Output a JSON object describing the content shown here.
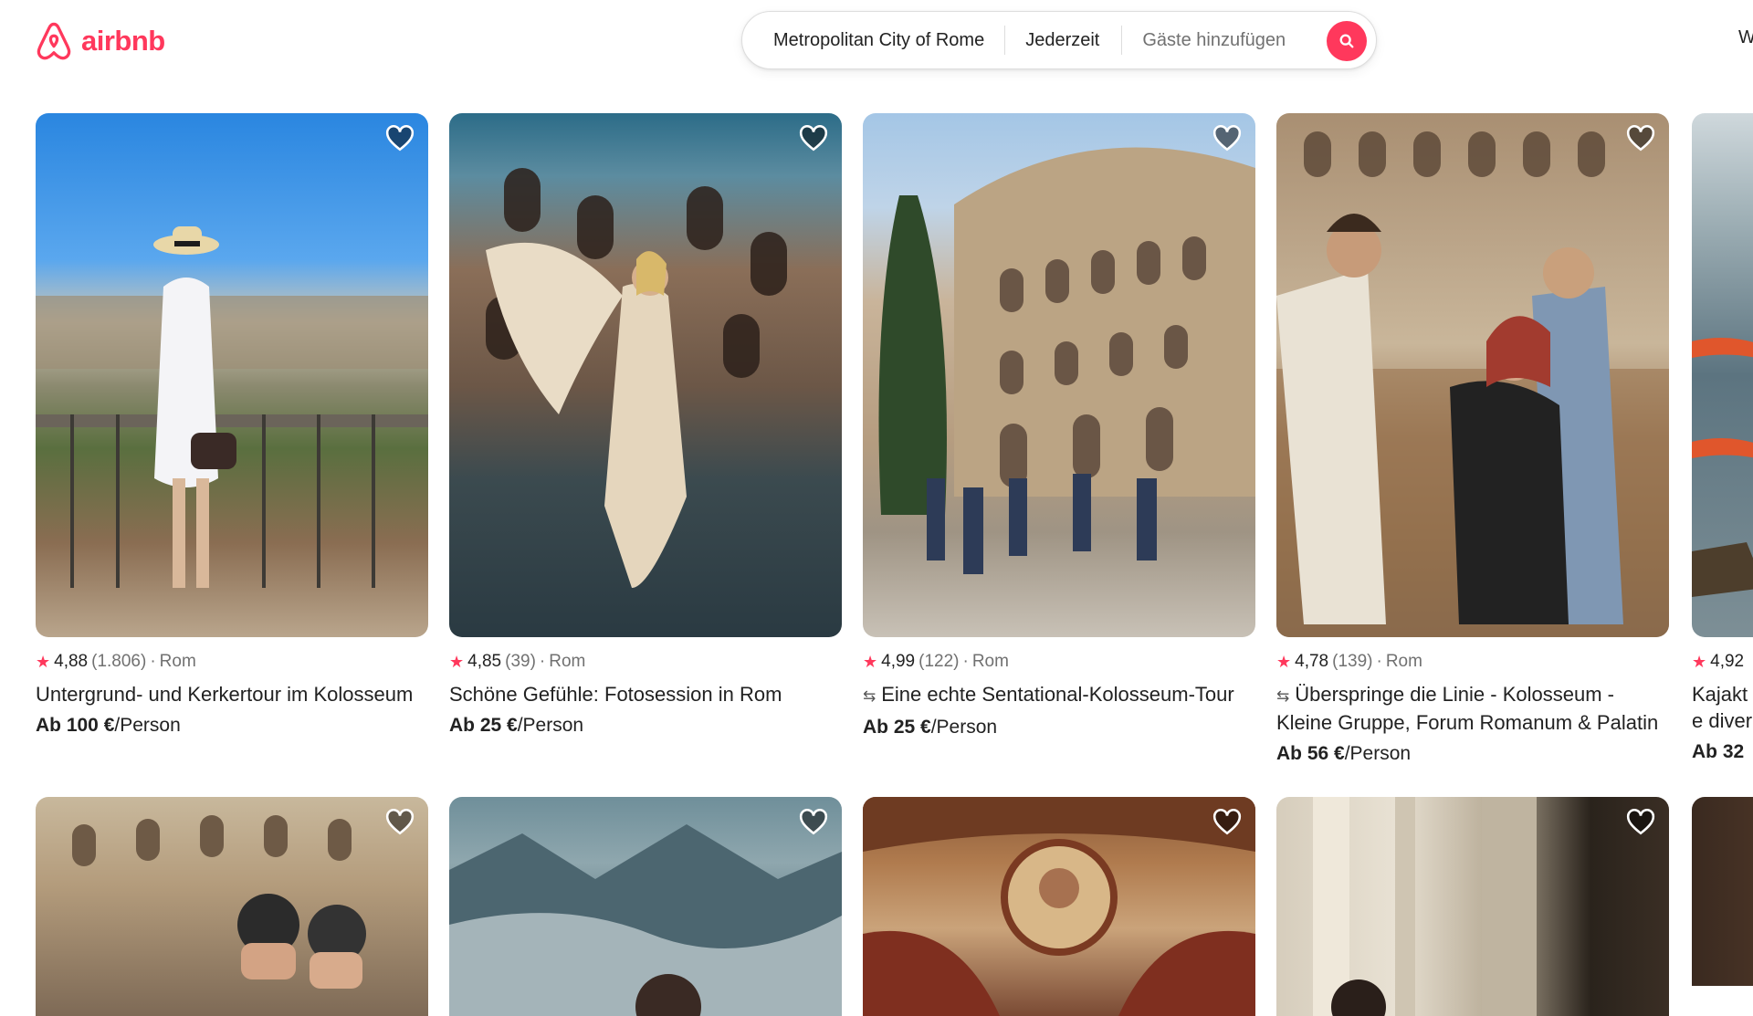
{
  "brand": {
    "name": "airbnb",
    "color": "#FF385C"
  },
  "search": {
    "location": "Metropolitan City of Rome",
    "dates": "Jederzeit",
    "guests_placeholder": "Gäste hinzufügen",
    "button_icon": "search-icon"
  },
  "header_right_text": "W",
  "listings": [
    {
      "rating": "4,88",
      "reviews": "(1.806)",
      "location": "Rom",
      "title": "Untergrund- und Kerkertour im Kolosseum",
      "translated": false,
      "price_prefix": "Ab ",
      "price": "100 €",
      "price_unit": "/Person"
    },
    {
      "rating": "4,85",
      "reviews": "(39)",
      "location": "Rom",
      "title": "Schöne Gefühle: Fotosession in Rom",
      "translated": false,
      "price_prefix": "Ab ",
      "price": "25 €",
      "price_unit": "/Person"
    },
    {
      "rating": "4,99",
      "reviews": "(122)",
      "location": "Rom",
      "title": "Eine echte Sentational-Kolosseum-Tour",
      "translated": true,
      "price_prefix": "Ab ",
      "price": "25 €",
      "price_unit": "/Person"
    },
    {
      "rating": "4,78",
      "reviews": "(139)",
      "location": "Rom",
      "title": "Überspringe die Linie - Kolosseum - Kleine Gruppe, Forum Romanum & Palatin",
      "translated": true,
      "price_prefix": "Ab ",
      "price": "56 €",
      "price_unit": "/Person"
    },
    {
      "rating": "4,92",
      "reviews": "",
      "location": "",
      "title_line1": "Kajakt",
      "title_line2": "e diver",
      "price_prefix": "Ab ",
      "price": "32"
    }
  ],
  "icons": {
    "favorite": "heart-icon",
    "rating": "star-icon",
    "translated": "translate-icon"
  }
}
